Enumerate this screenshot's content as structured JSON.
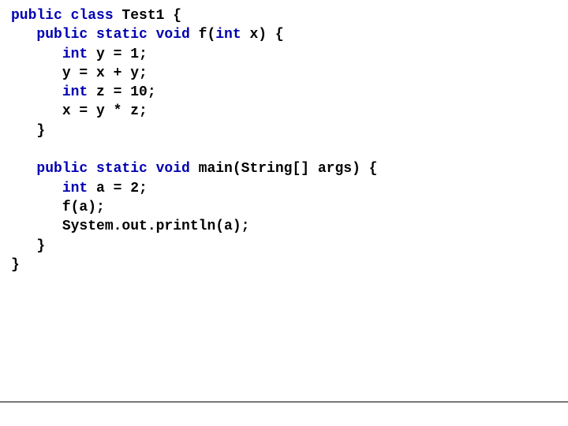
{
  "colors": {
    "keyword": "#0000b3",
    "text": "#000000",
    "background": "#ffffff"
  },
  "code": {
    "line1": {
      "kw1": "public class",
      "t1": " Test1 {"
    },
    "line2": {
      "indent": "   ",
      "kw1": "public static void",
      "t1": " f(",
      "kw2": "int",
      "t2": " x) {"
    },
    "line3": {
      "indent": "      ",
      "kw1": "int",
      "t1": " y = 1;"
    },
    "line4": {
      "indent": "      ",
      "t1": "y = x + y;"
    },
    "line5": {
      "indent": "      ",
      "kw1": "int",
      "t1": " z = 10;"
    },
    "line6": {
      "indent": "      ",
      "t1": "x = y * z;"
    },
    "line7": {
      "indent": "   ",
      "t1": "}"
    },
    "blank1": " ",
    "line8": {
      "indent": "   ",
      "kw1": "public static void",
      "t1": " main(String[] args) {"
    },
    "line9": {
      "indent": "      ",
      "kw1": "int",
      "t1": " a = 2;"
    },
    "line10": {
      "indent": "      ",
      "t1": "f(a);"
    },
    "line11": {
      "indent": "      ",
      "t1": "System.out.println(a);"
    },
    "line12": {
      "indent": "   ",
      "t1": "}"
    },
    "line13": {
      "t1": "}"
    }
  }
}
